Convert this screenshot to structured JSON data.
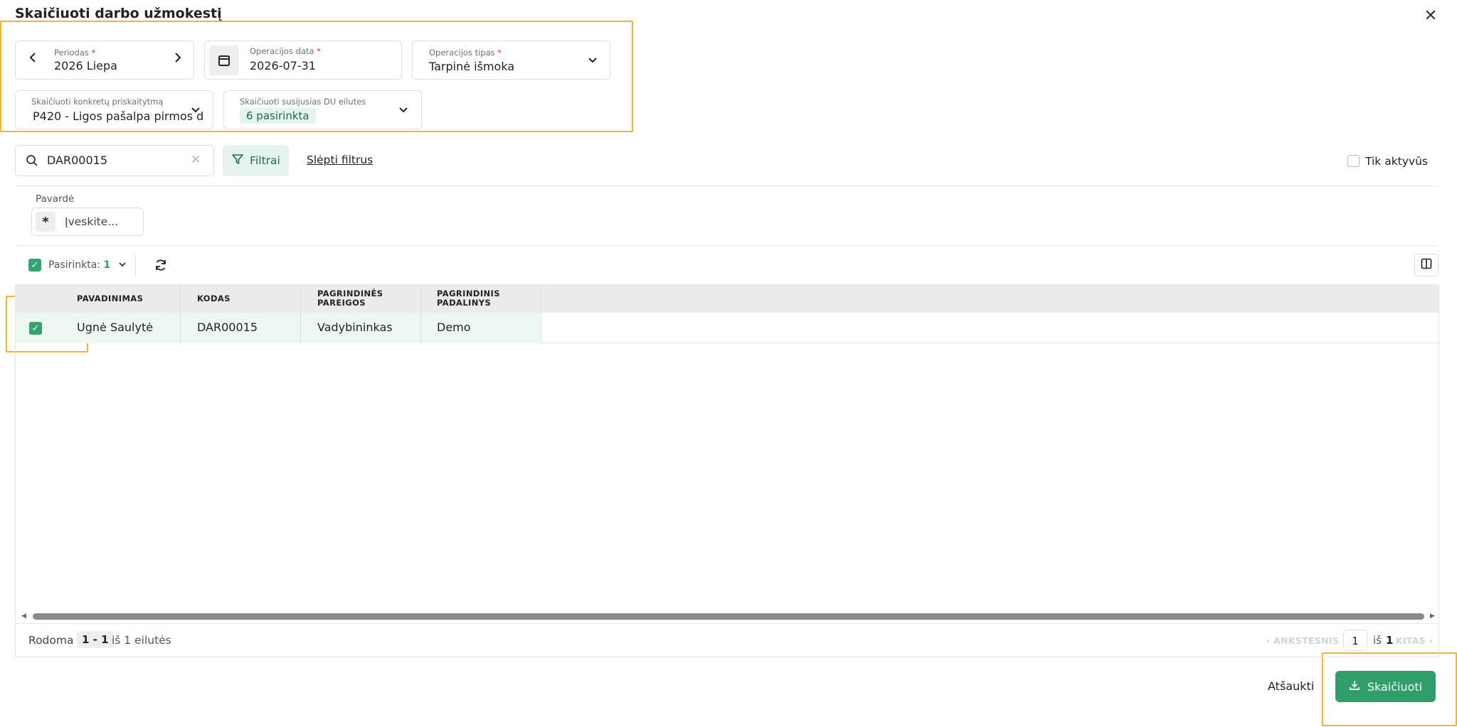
{
  "dialog": {
    "title": "Skaičiuoti darbo užmokestį"
  },
  "period": {
    "label": "Periodas",
    "required": "*",
    "value": "2026 Liepa"
  },
  "op_date": {
    "label": "Operacijos data",
    "required": "*",
    "value": "2026-07-31"
  },
  "op_type": {
    "label": "Operacijos tipas",
    "required": "*",
    "value": "Tarpinė išmoka"
  },
  "specific": {
    "label": "Skaičiuoti konkretų priskaitytmą",
    "value": "P420 - Ligos pašalpa pirmos d"
  },
  "related": {
    "label": "Skaičiuoti susijusias DU eilutes",
    "tag": "6 pasirinkta"
  },
  "search": {
    "value": "DAR00015"
  },
  "filters": {
    "button": "Filtrai",
    "hide": "Slėpti filtrus",
    "only_active": "Tik aktyvūs"
  },
  "surname_filter": {
    "label": "Pavardė",
    "operator": "*",
    "placeholder": "Įveskite..."
  },
  "selection": {
    "label": "Pasirinkta:",
    "count": "1"
  },
  "table": {
    "headers": [
      "PAVADINIMAS",
      "KODAS",
      "PAGRINDINĖS PAREIGOS",
      "PAGRINDINIS PADALINYS"
    ],
    "rows": [
      {
        "name": "Ugnė Saulytė",
        "code": "DAR00015",
        "position": "Vadybininkas",
        "department": "Demo"
      }
    ]
  },
  "footer": {
    "showing": "Rodoma",
    "range": "1 - 1",
    "of_rows": "iš 1 eilutės",
    "prev": "ANKSTESNIS",
    "page": "1",
    "of": "iš",
    "total": "1",
    "next": "KITAS"
  },
  "actions": {
    "cancel": "Atšaukti",
    "calculate": "Skaičiuoti"
  },
  "colors": {
    "accent": "#2f9e6a",
    "highlight": "#f5b52a",
    "tag_bg": "#e6f4ee",
    "row_bg": "#eef8f3"
  }
}
